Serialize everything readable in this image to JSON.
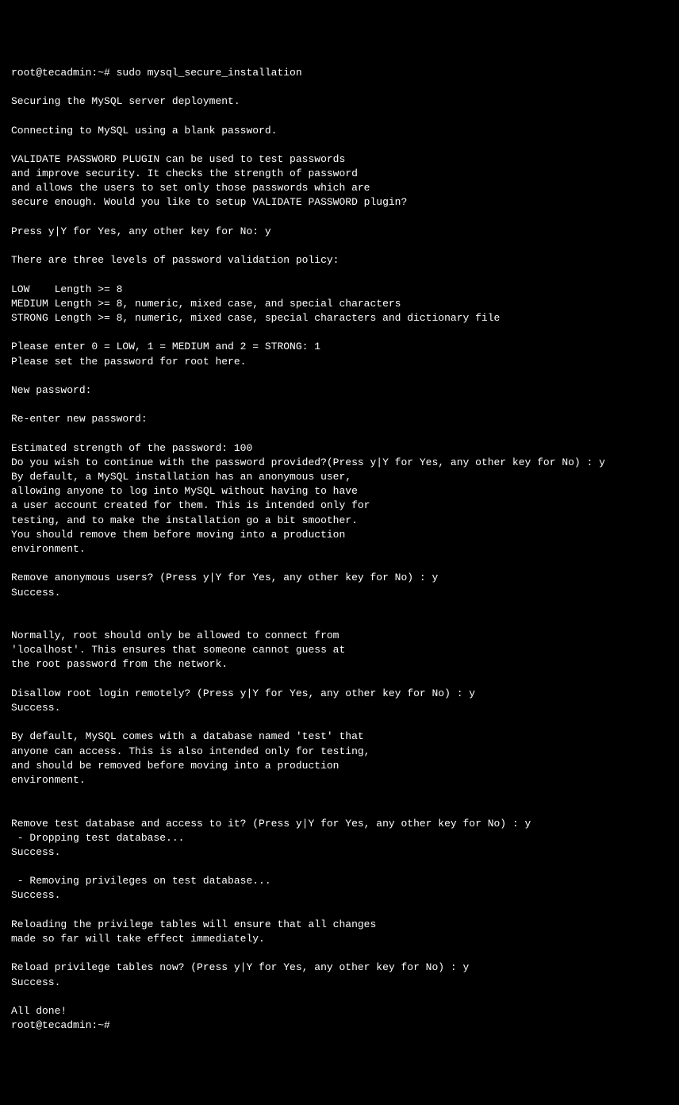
{
  "terminal": {
    "prompt1": "root@tecadmin:~# sudo mysql_secure_installation",
    "blank1": "",
    "line1": "Securing the MySQL server deployment.",
    "blank2": "",
    "line2": "Connecting to MySQL using a blank password.",
    "blank3": "",
    "line3": "VALIDATE PASSWORD PLUGIN can be used to test passwords",
    "line4": "and improve security. It checks the strength of password",
    "line5": "and allows the users to set only those passwords which are",
    "line6": "secure enough. Would you like to setup VALIDATE PASSWORD plugin?",
    "blank4": "",
    "line7": "Press y|Y for Yes, any other key for No: y",
    "blank5": "",
    "line8": "There are three levels of password validation policy:",
    "blank6": "",
    "line9": "LOW    Length >= 8",
    "line10": "MEDIUM Length >= 8, numeric, mixed case, and special characters",
    "line11": "STRONG Length >= 8, numeric, mixed case, special characters and dictionary file",
    "blank7": "",
    "line12": "Please enter 0 = LOW, 1 = MEDIUM and 2 = STRONG: 1",
    "line13": "Please set the password for root here.",
    "blank8": "",
    "line14": "New password:",
    "blank9": "",
    "line15": "Re-enter new password:",
    "blank10": "",
    "line16": "Estimated strength of the password: 100",
    "line17": "Do you wish to continue with the password provided?(Press y|Y for Yes, any other key for No) : y",
    "line18": "By default, a MySQL installation has an anonymous user,",
    "line19": "allowing anyone to log into MySQL without having to have",
    "line20": "a user account created for them. This is intended only for",
    "line21": "testing, and to make the installation go a bit smoother.",
    "line22": "You should remove them before moving into a production",
    "line23": "environment.",
    "blank11": "",
    "line24": "Remove anonymous users? (Press y|Y for Yes, any other key for No) : y",
    "line25": "Success.",
    "blank12": "",
    "blank13": "",
    "line26": "Normally, root should only be allowed to connect from",
    "line27": "'localhost'. This ensures that someone cannot guess at",
    "line28": "the root password from the network.",
    "blank14": "",
    "line29": "Disallow root login remotely? (Press y|Y for Yes, any other key for No) : y",
    "line30": "Success.",
    "blank15": "",
    "line31": "By default, MySQL comes with a database named 'test' that",
    "line32": "anyone can access. This is also intended only for testing,",
    "line33": "and should be removed before moving into a production",
    "line34": "environment.",
    "blank16": "",
    "blank17": "",
    "line35": "Remove test database and access to it? (Press y|Y for Yes, any other key for No) : y",
    "line36": " - Dropping test database...",
    "line37": "Success.",
    "blank18": "",
    "line38": " - Removing privileges on test database...",
    "line39": "Success.",
    "blank19": "",
    "line40": "Reloading the privilege tables will ensure that all changes",
    "line41": "made so far will take effect immediately.",
    "blank20": "",
    "line42": "Reload privilege tables now? (Press y|Y for Yes, any other key for No) : y",
    "line43": "Success.",
    "blank21": "",
    "line44": "All done!",
    "prompt2": "root@tecadmin:~#"
  }
}
